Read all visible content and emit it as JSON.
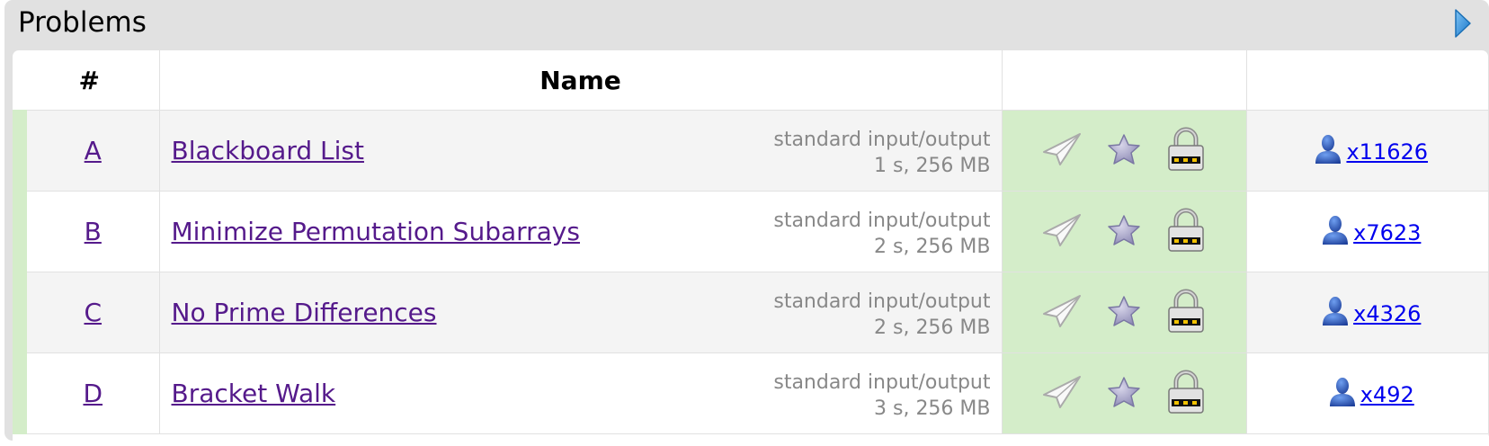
{
  "panel": {
    "title": "Problems",
    "toggle_icon": "triangle-right-icon"
  },
  "table": {
    "headers": [
      "#",
      "Name",
      "",
      ""
    ],
    "rows": [
      {
        "index": "A",
        "name": "Blackboard List",
        "io": "standard input/output",
        "limits": "1 s, 256 MB",
        "solved": "x11626"
      },
      {
        "index": "B",
        "name": "Minimize Permutation Subarrays",
        "io": "standard input/output",
        "limits": "2 s, 256 MB",
        "solved": "x7623"
      },
      {
        "index": "C",
        "name": "No Prime Differences",
        "io": "standard input/output",
        "limits": "2 s, 256 MB",
        "solved": "x4326"
      },
      {
        "index": "D",
        "name": "Bracket Walk",
        "io": "standard input/output",
        "limits": "3 s, 256 MB",
        "solved": "x492"
      }
    ]
  },
  "icons": {
    "submit": "paper-plane-icon",
    "favourite": "star-icon",
    "lock": "padlock-icon",
    "solvers": "user-icon"
  },
  "colors": {
    "link": "#551a8b",
    "count_link": "#0000ee",
    "accepted_bg": "#d4edc9",
    "panel_bg": "#e1e1e1"
  }
}
